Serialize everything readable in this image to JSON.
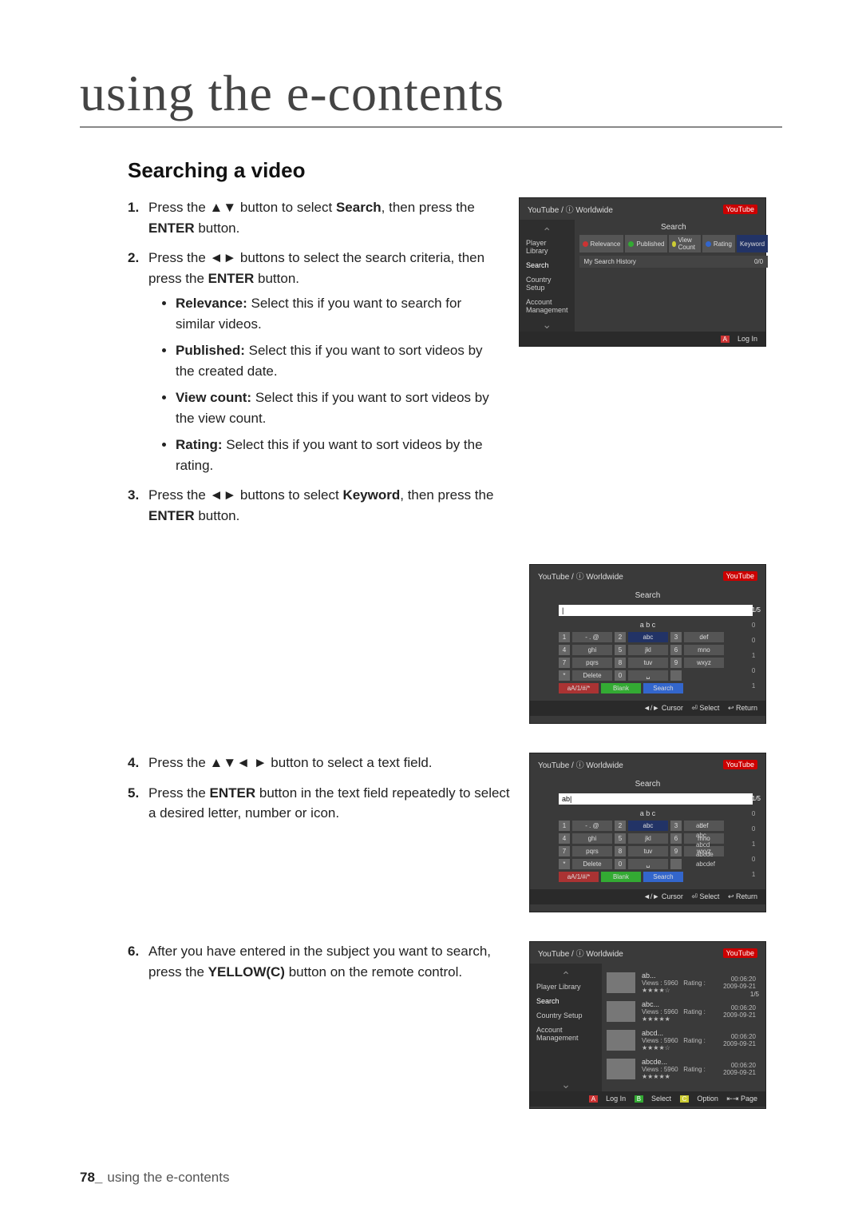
{
  "page": {
    "title": "using the e-contents",
    "section": "Searching a video",
    "footer_num": "78_",
    "footer_text": "using the e-contents"
  },
  "steps": {
    "s1a": "Press the ",
    "s1b": " button to select ",
    "s1c": "Search",
    "s1d": ", then press the ",
    "s1e": "ENTER",
    "s1f": " button.",
    "s2a": "Press the ",
    "s2b": " buttons to select the search criteria, then press the ",
    "s2c": "ENTER",
    "s2d": " button.",
    "b1a": "Relevance:",
    "b1b": " Select this if you want to search for similar videos.",
    "b2a": "Published:",
    "b2b": " Select this if you want to sort videos by the created date.",
    "b3a": "View count:",
    "b3b": " Select this if you want to sort videos by the view count.",
    "b4a": "Rating:",
    "b4b": " Select this if you want to sort videos by the rating.",
    "s3a": "Press the ",
    "s3b": " buttons to select ",
    "s3c": "Keyword",
    "s3d": ", then press the ",
    "s3e": "ENTER",
    "s3f": " button.",
    "s4a": "Press the ",
    "s4b": " button to select a text field.",
    "s5a": "Press the ",
    "s5b": "ENTER",
    "s5c": " button in the text field repeatedly to select a desired letter, number or icon.",
    "s6a": "After you have entered in the subject you want to search, press the ",
    "s6b": "YELLOW(C)",
    "s6c": " button on the remote control."
  },
  "arrows": {
    "ud": "▲▼",
    "lr": "◄►",
    "all": "▲▼◄ ►"
  },
  "shot": {
    "header": "YouTube / ⓘ Worldwide",
    "logo": "YouTube",
    "sidebar": {
      "i0": "Player Library",
      "i1": "Search",
      "i2": "Country Setup",
      "i3": "Account Management"
    },
    "search_title": "Search",
    "criteria": {
      "c0": "Relevance",
      "c1": "Published",
      "c2": "View Count",
      "c3": "Rating",
      "c4": "Keyword"
    },
    "history": "My Search History",
    "history_count": "0/0",
    "login": "Log In",
    "abc": "a b c",
    "input1": "|",
    "input2": "ab|",
    "keys": {
      "r0": [
        "1",
        "- . @",
        "2",
        "abc",
        "3",
        "def"
      ],
      "r1": [
        "4",
        "ghi",
        "5",
        "jkl",
        "6",
        "mno"
      ],
      "r2": [
        "7",
        "pqrs",
        "8",
        "tuv",
        "9",
        "wxyz"
      ],
      "r3": [
        "*",
        "Delete",
        "0",
        "␣",
        "",
        ""
      ],
      "r4": [
        "",
        "aA/1/#/*",
        "",
        "Blank",
        "",
        "Search"
      ]
    },
    "hints": {
      "cur": "◄/► Cursor",
      "sel": "⏎ Select",
      "ret": "↩ Return"
    },
    "count": "1/5",
    "sidec": [
      "0",
      "0",
      "1",
      "0",
      "1"
    ],
    "sugg": [
      "ab",
      "abc",
      "abcd",
      "abcde",
      "abcdef"
    ],
    "results": [
      {
        "t": "ab...",
        "v": "Views : 5960",
        "r": "Rating : ★★★★☆",
        "d": "00:06:20",
        "dt": "2009-09-21"
      },
      {
        "t": "abc...",
        "v": "Views : 5960",
        "r": "Rating : ★★★★★",
        "d": "00:06:20",
        "dt": "2009-09-21"
      },
      {
        "t": "abcd...",
        "v": "Views : 5960",
        "r": "Rating : ★★★★☆",
        "d": "00:06:20",
        "dt": "2009-09-21"
      },
      {
        "t": "abcde...",
        "v": "Views : 5960",
        "r": "Rating : ★★★★★",
        "d": "00:06:20",
        "dt": "2009-09-21"
      }
    ],
    "footer2": {
      "a": "Log In",
      "b": "Select",
      "c": "Option",
      "d": "⇤⇥ Page"
    }
  }
}
